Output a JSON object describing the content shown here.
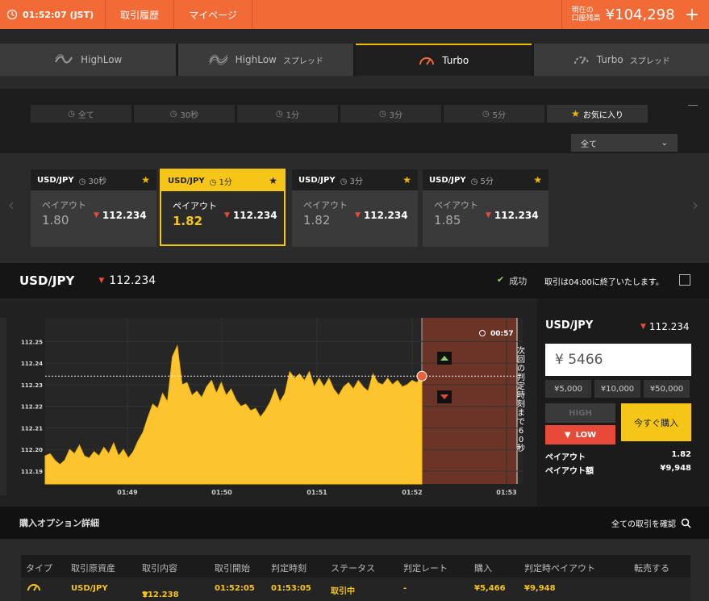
{
  "topbar": {
    "time": "01:52:07 (JST)",
    "nav": [
      "取引履歴",
      "マイページ"
    ],
    "balance_label_1": "現在の",
    "balance_label_2": "口座残高",
    "balance_amount": "¥104,298",
    "plus": "+"
  },
  "product_tabs": [
    {
      "label": "HighLow",
      "sub": "",
      "icon": "highlow-icon"
    },
    {
      "label": "HighLow",
      "sub": "スプレッド",
      "icon": "highlow-spread-icon"
    },
    {
      "label": "Turbo",
      "sub": "",
      "icon": "turbo-icon"
    },
    {
      "label": "Turbo",
      "sub": "スプレッド",
      "icon": "turbo-spread-icon"
    }
  ],
  "filters": [
    "全て",
    "30秒",
    "1分",
    "3分",
    "5分"
  ],
  "favorite_label": "お気に入り",
  "select_value": "全て",
  "cards": [
    {
      "pair": "USD/JPY",
      "duration": "30秒",
      "payout_label": "ペイアウト",
      "payout": "1.80",
      "rate": "112.234"
    },
    {
      "pair": "USD/JPY",
      "duration": "1分",
      "payout_label": "ペイアウト",
      "payout": "1.82",
      "rate": "112.234"
    },
    {
      "pair": "USD/JPY",
      "duration": "3分",
      "payout_label": "ペイアウト",
      "payout": "1.82",
      "rate": "112.234"
    },
    {
      "pair": "USD/JPY",
      "duration": "5分",
      "payout_label": "ペイアウト",
      "payout": "1.85",
      "rate": "112.234"
    }
  ],
  "pairbar": {
    "pair": "USD/JPY",
    "rate": "112.234",
    "status": "成功",
    "message": "取引は04:00に終了いたします。"
  },
  "chart_data": {
    "type": "area",
    "y_ticks": [
      "112.25",
      "112.24",
      "112.23",
      "112.22",
      "112.21",
      "112.20",
      "112.19"
    ],
    "x_ticks": [
      "01:49",
      "01:50",
      "01:51",
      "01:52",
      "01:53"
    ],
    "countdown": "00:57",
    "vertical_text": "次回の判定時刻まで60秒",
    "current_rate_line": 112.234,
    "ylim": [
      112.184,
      112.261
    ],
    "values": [
      112.197,
      112.198,
      112.195,
      112.193,
      112.195,
      112.2,
      112.198,
      112.202,
      112.197,
      112.196,
      112.199,
      112.197,
      112.201,
      112.198,
      112.203,
      112.197,
      112.2,
      112.196,
      112.199,
      112.204,
      112.208,
      112.215,
      112.221,
      112.219,
      112.226,
      112.222,
      112.243,
      112.248,
      112.23,
      112.231,
      112.225,
      112.227,
      112.224,
      112.229,
      112.232,
      112.226,
      112.231,
      112.225,
      112.228,
      112.223,
      112.22,
      112.221,
      112.218,
      112.219,
      112.215,
      112.218,
      112.222,
      112.228,
      112.222,
      112.226,
      112.236,
      112.233,
      112.235,
      112.232,
      112.236,
      112.229,
      112.233,
      112.229,
      112.233,
      112.228,
      112.225,
      112.229,
      112.231,
      112.228,
      112.232,
      112.229,
      112.227,
      112.235,
      112.231,
      112.23,
      112.233,
      112.23,
      112.232,
      112.229,
      112.23,
      112.232,
      112.231,
      112.234
    ]
  },
  "trade": {
    "pair": "USD/JPY",
    "rate": "112.234",
    "amount": "¥ 5466",
    "quick": [
      "¥5,000",
      "¥10,000",
      "¥50,000"
    ],
    "high": "HIGH",
    "low": "LOW",
    "buy": "今すぐ購入",
    "payout_label": "ペイアウト",
    "payout": "1.82",
    "payout_amount_label": "ペイアウト額",
    "payout_amount": "¥9,948"
  },
  "details": {
    "title": "購入オプション詳細",
    "link": "全ての取引を確認"
  },
  "table": {
    "headers": [
      "タイプ",
      "取引原資産",
      "取引内容",
      "取引開始",
      "判定時刻",
      "ステータス",
      "判定レート",
      "購入",
      "判定時ペイアウト",
      "転売する"
    ],
    "row": [
      "",
      "USD/JPY",
      "112.238",
      "01:52:05",
      "01:53:05",
      "取引中",
      "-",
      "¥5,466",
      "¥9,948",
      ""
    ]
  },
  "colors": {
    "accent": "#f26a36",
    "yellow": "#f5c518",
    "low": "#e84a3a",
    "ok": "#8bd06b"
  }
}
